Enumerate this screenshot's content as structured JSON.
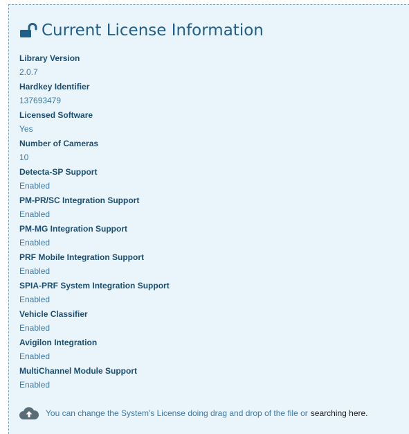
{
  "header": {
    "title": "Current License Information",
    "icon": "unlock-icon",
    "color": "#1f5f8a"
  },
  "fields": [
    {
      "label": "Library Version",
      "value": "2.0.7"
    },
    {
      "label": "Hardkey Identifier",
      "value": "137693479"
    },
    {
      "label": "Licensed Software",
      "value": "Yes"
    },
    {
      "label": "Number of Cameras",
      "value": "10"
    },
    {
      "label": "Detecta-SP Support",
      "value": "Enabled"
    },
    {
      "label": "PM-PR/SC Integration Support",
      "value": "Enabled"
    },
    {
      "label": "PM-MG Integration Support",
      "value": "Enabled"
    },
    {
      "label": "PRF Mobile Integration Support",
      "value": "Enabled"
    },
    {
      "label": "SPIA-PRF System Integration Support",
      "value": "Enabled"
    },
    {
      "label": "Vehicle Classifier",
      "value": "Enabled"
    },
    {
      "label": "Avigilon Integration",
      "value": "Enabled"
    },
    {
      "label": "MultiChannel Module Support",
      "value": "Enabled"
    }
  ],
  "footer": {
    "icon": "cloud-upload-icon",
    "text": "You can change the System's License doing drag and drop of the file or",
    "link": "searching here",
    "period": "."
  },
  "colors": {
    "panel_background": "#eaf4fb",
    "label": "#1b4f72",
    "value": "#3d7aa8"
  }
}
